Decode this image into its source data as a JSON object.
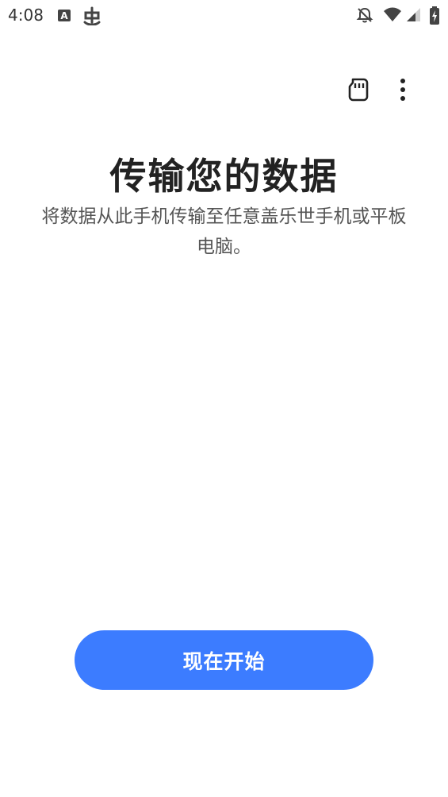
{
  "status_bar": {
    "time": "4:08",
    "icons": [
      "a-font-icon",
      "bug-icon",
      "notifications-off-icon",
      "wifi-icon",
      "signal-icon",
      "battery-charging-icon"
    ]
  },
  "toolbar": {
    "icons": [
      "sd-card-icon",
      "more-vert-icon"
    ]
  },
  "main": {
    "title": "传输您的数据",
    "subtitle": "将数据从此手机传输至任意盖乐世手机或平板电脑。",
    "start_button_label": "现在开始"
  },
  "colors": {
    "accent": "#3c7cff",
    "title": "#222222",
    "subtitle": "#555555",
    "background": "#ffffff"
  }
}
